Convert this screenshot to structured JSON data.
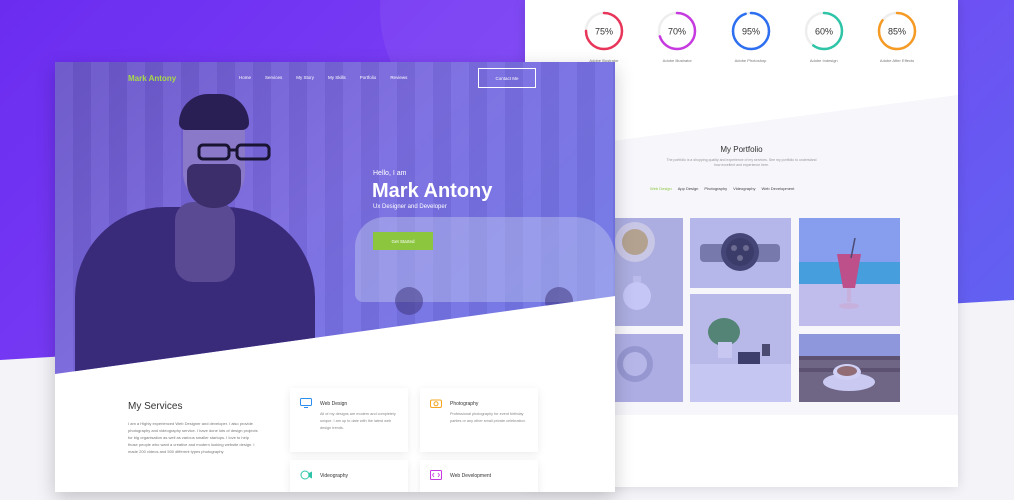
{
  "colors": {
    "accent": "#8cc63f",
    "purple": "#7a3ff5"
  },
  "skills": [
    {
      "percent": "75%",
      "value": 75,
      "name": "Adobe Illustrator",
      "color": "#e8365a"
    },
    {
      "percent": "70%",
      "value": 70,
      "name": "Adobe Illustrator",
      "color": "#c63ae0"
    },
    {
      "percent": "95%",
      "value": 95,
      "name": "Adobe Photoshop",
      "color": "#2d6ff0"
    },
    {
      "percent": "60%",
      "value": 60,
      "name": "Adobe Indesign",
      "color": "#2ec4a8"
    },
    {
      "percent": "85%",
      "value": 85,
      "name": "Adobe After Effects",
      "color": "#f59a23"
    }
  ],
  "portfolio": {
    "title": "My Portfolio",
    "description": "The portfolio is a shopping quality and experience of my services. See my portfolio to understand how excellent and experience here.",
    "tabs": [
      "Web Design",
      "App Design",
      "Photography",
      "Videography",
      "Web Development"
    ]
  },
  "left": {
    "logo": "Mark Antony",
    "nav": [
      "Home",
      "Services",
      "My Story",
      "My Skills",
      "Portfolio",
      "Reviews"
    ],
    "contact": "Contact Me",
    "hello": "Hello, I am",
    "name": "Mark Antony",
    "role": "Ux Designer and Developer",
    "cta": "Get Started",
    "services_title": "My Services",
    "services_text": "I am a Highly experienced Web Designer and developer. I also provide photography and videography service. I have done lots of design projects for big organisation as well as various smaller startups. I love to help those people who want a creative and modern looking website design. I made 200 videos and 500 different types photography",
    "cards": [
      {
        "title": "Web Design",
        "desc": "All of my designs are modern and completely unique. I am up to date with the latest web design trends.",
        "icon": "monitor-icon"
      },
      {
        "title": "Photography",
        "desc": "Professional photography for event birthday parties or any other small private celebration.",
        "icon": "camera-icon"
      },
      {
        "title": "Videography",
        "desc": "",
        "icon": "video-icon"
      },
      {
        "title": "Web Development",
        "desc": "",
        "icon": "code-icon"
      }
    ]
  }
}
